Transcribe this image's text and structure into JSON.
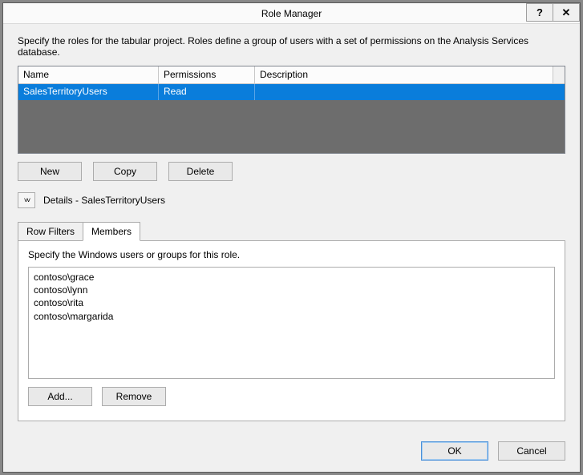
{
  "window": {
    "title": "Role Manager",
    "help_label": "?",
    "close_label": "✕"
  },
  "instruction": "Specify the roles for the tabular project. Roles define a group of users with a set of permissions on the Analysis Services database.",
  "grid": {
    "headers": {
      "name": "Name",
      "permissions": "Permissions",
      "description": "Description"
    },
    "rows": [
      {
        "name": "SalesTerritoryUsers",
        "permissions": "Read",
        "description": ""
      }
    ]
  },
  "buttons": {
    "new": "New",
    "copy": "Copy",
    "delete": "Delete"
  },
  "details": {
    "toggle_glyph": "˅˅",
    "label": "Details - SalesTerritoryUsers"
  },
  "tabs": {
    "row_filters": "Row Filters",
    "members": "Members"
  },
  "members_panel": {
    "instruction": "Specify the Windows users or groups for this role.",
    "items": [
      "contoso\\grace",
      "contoso\\lynn",
      "contoso\\rita",
      "contoso\\margarida"
    ],
    "add": "Add...",
    "remove": "Remove"
  },
  "footer": {
    "ok": "OK",
    "cancel": "Cancel"
  }
}
